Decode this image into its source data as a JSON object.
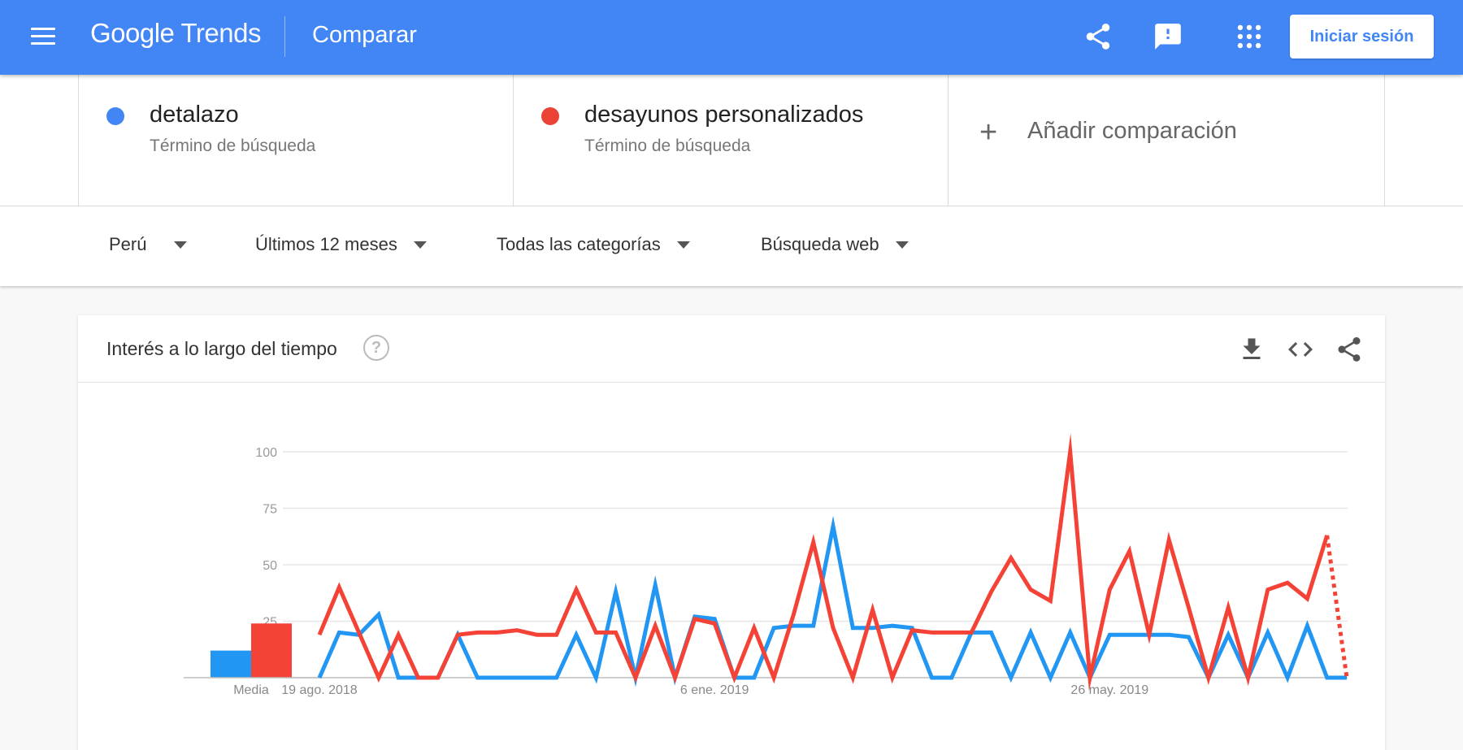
{
  "header": {
    "logo_google": "Google",
    "logo_trends": "Trends",
    "title": "Comparar",
    "signin_label": "Iniciar sesión",
    "icons": [
      "menu-icon",
      "share-icon",
      "feedback-icon",
      "apps-icon"
    ],
    "brand_color": "#4285f4"
  },
  "terms": [
    {
      "name": "detalazo",
      "type": "Término de búsqueda",
      "color": "#4285f4"
    },
    {
      "name": "desayunos personalizados",
      "type": "Término de búsqueda",
      "color": "#ea4335"
    }
  ],
  "add_comparison": {
    "icon": "+",
    "label": "Añadir comparación"
  },
  "filters": {
    "region": "Perú",
    "period": "Últimos 12 meses",
    "category": "Todas las categorías",
    "search_type": "Búsqueda web"
  },
  "card": {
    "title": "Interés a lo largo del tiempo",
    "help_icon": "?",
    "icons": [
      "download-icon",
      "embed-icon",
      "share-icon"
    ]
  },
  "chart_data": {
    "type": "line",
    "ylim": [
      0,
      100
    ],
    "yticks": [
      25,
      50,
      75,
      100
    ],
    "x_tick_labels": [
      {
        "label": "19 ago. 2018",
        "index": 0
      },
      {
        "label": "6 ene. 2019",
        "index": 20
      },
      {
        "label": "26 may. 2019",
        "index": 40
      }
    ],
    "series": [
      {
        "name": "detalazo",
        "color": "#2196f3",
        "values": [
          0,
          20,
          19,
          28,
          0,
          0,
          0,
          19,
          0,
          0,
          0,
          0,
          0,
          19,
          0,
          38,
          0,
          41,
          0,
          27,
          26,
          0,
          0,
          22,
          23,
          23,
          67,
          22,
          22,
          23,
          22,
          0,
          0,
          20,
          20,
          0,
          20,
          0,
          20,
          0,
          19,
          19,
          19,
          19,
          18,
          0,
          19,
          0,
          20,
          0,
          23,
          0,
          0
        ]
      },
      {
        "name": "desayunos personalizados",
        "color": "#f44336",
        "values": [
          19,
          40,
          20,
          0,
          19,
          0,
          0,
          19,
          20,
          20,
          21,
          19,
          19,
          39,
          20,
          20,
          0,
          23,
          0,
          26,
          24,
          0,
          22,
          0,
          28,
          60,
          22,
          0,
          30,
          0,
          21,
          20,
          20,
          20,
          38,
          53,
          39,
          34,
          100,
          0,
          39,
          56,
          19,
          61,
          31,
          0,
          31,
          0,
          39,
          42,
          35,
          63,
          0
        ],
        "partial_last": true
      }
    ],
    "average": {
      "label": "Media",
      "values": [
        12,
        24
      ]
    }
  }
}
